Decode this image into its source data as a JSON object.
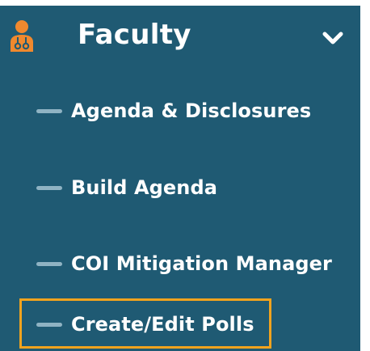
{
  "menu": {
    "title": "Faculty",
    "icon": "faculty-doctor-icon",
    "expand_icon": "chevron-down-icon",
    "accent_color": "#f0892e",
    "background_color": "#1f5a73",
    "highlight_color": "#f0a31e",
    "items": [
      {
        "label": "Agenda & Disclosures"
      },
      {
        "label": "Build Agenda"
      },
      {
        "label": "COI Mitigation Manager"
      },
      {
        "label": "Create/Edit Polls",
        "selected": true
      }
    ]
  }
}
